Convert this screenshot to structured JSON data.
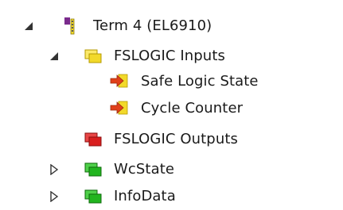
{
  "tree": {
    "term": {
      "label": "Term 4 (EL6910)",
      "expanded": true,
      "icon": "terminal-icon"
    },
    "fslogic_inputs": {
      "label": "FSLOGIC Inputs",
      "expanded": true,
      "icon": "input-group-icon",
      "children": [
        {
          "label": "Safe Logic State",
          "icon": "input-variable-icon"
        },
        {
          "label": "Cycle Counter",
          "icon": "input-variable-icon"
        }
      ]
    },
    "fslogic_outputs": {
      "label": "FSLOGIC Outputs",
      "icon": "output-group-icon"
    },
    "wcstate": {
      "label": "WcState",
      "expanded": false,
      "icon": "status-group-icon"
    },
    "infodata": {
      "label": "InfoData",
      "expanded": false,
      "icon": "status-group-icon"
    }
  },
  "colors": {
    "input_group": "#f2d92a",
    "output_group": "#d91e1e",
    "status_group": "#22b51f",
    "variable_arrow": "#e0401a",
    "terminal_purple": "#7a2b8c",
    "toggle": "#333333"
  }
}
